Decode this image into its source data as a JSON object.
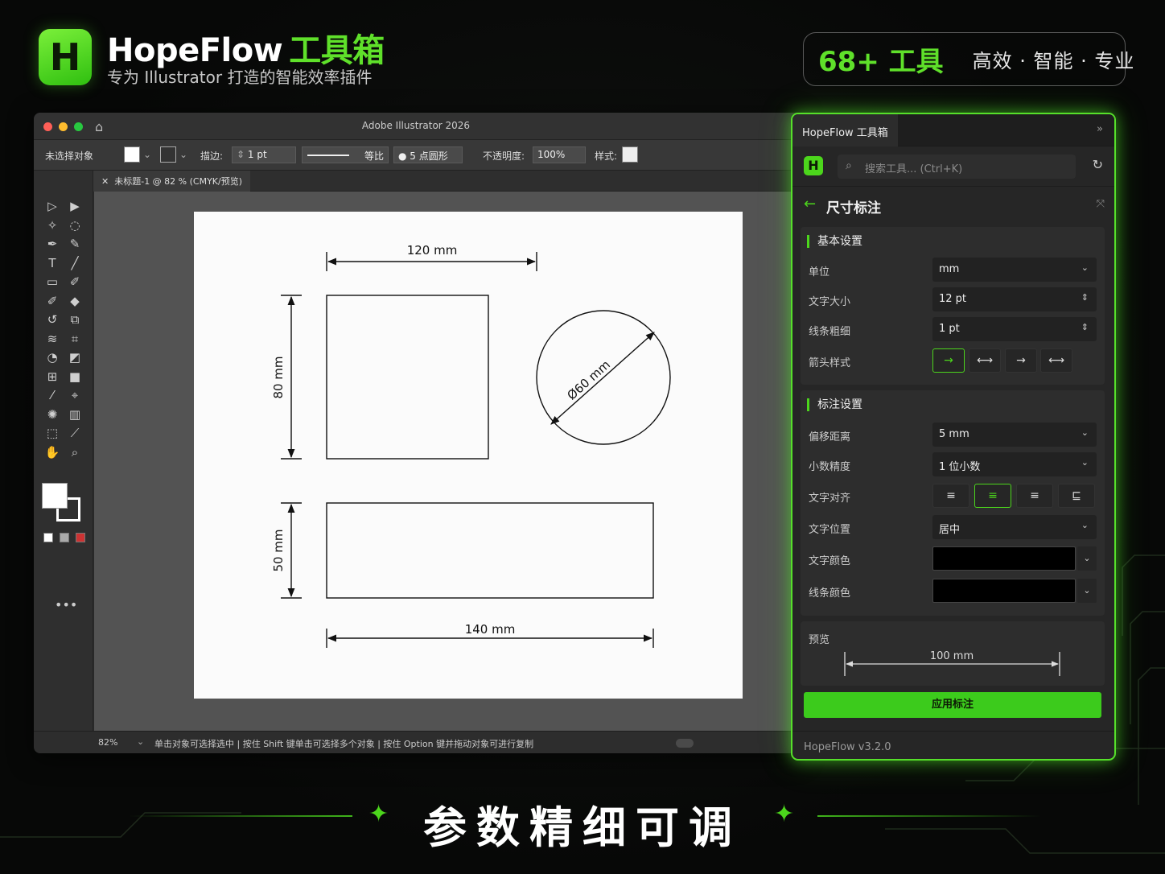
{
  "brand": {
    "logo_letter": "H",
    "name": "HopeFlow",
    "name_cn": "工具箱",
    "subtitle": "专为 Illustrator 打造的智能效率插件"
  },
  "badge": {
    "count": "68+ 工具",
    "tagline": "高效 · 智能 · 专业"
  },
  "illustrator": {
    "window_title": "Adobe Illustrator 2026",
    "control_bar": {
      "selection": "未选择对象",
      "stroke_label": "描边:",
      "stroke_value": "1 pt",
      "profile": "等比",
      "brush": "● 5 点圆形",
      "opacity_label": "不透明度:",
      "opacity_value": "100%",
      "style_label": "样式:"
    },
    "document_tab": "未标题-1 @ 82 % (CMYK/预览)",
    "status": {
      "zoom": "82%",
      "hint": "单击对象可选择选中 | 按住 Shift 键单击可选择多个对象 | 按住 Option 键并拖动对象可进行复制"
    },
    "drawing": {
      "dim_top": "120 mm",
      "dim_left_upper": "80 mm",
      "dim_circle": "Ø60 mm",
      "dim_left_lower": "50 mm",
      "dim_bottom": "140 mm"
    },
    "tools": [
      "selection",
      "direct-selection",
      "magic-wand",
      "lasso",
      "pen",
      "curvature",
      "type",
      "line",
      "rectangle",
      "paintbrush",
      "shaper",
      "eraser",
      "rotate",
      "scale",
      "width",
      "free-transform",
      "shape-builder",
      "perspective",
      "mesh",
      "gradient",
      "eyedropper",
      "blend",
      "symbol-sprayer",
      "column-graph",
      "artboard",
      "slice",
      "hand",
      "zoom"
    ]
  },
  "panel": {
    "tab_title": "HopeFlow 工具箱",
    "search_placeholder": "搜索工具... (Ctrl+K)",
    "page_title": "尺寸标注",
    "basic": {
      "title": "基本设置",
      "unit_label": "单位",
      "unit_value": "mm",
      "font_size_label": "文字大小",
      "font_size_value": "12 pt",
      "line_weight_label": "线条粗细",
      "line_weight_value": "1 pt",
      "arrow_label": "箭头样式",
      "arrow_options": [
        "→",
        "⟷",
        "→",
        "⟷"
      ]
    },
    "dimension": {
      "title": "标注设置",
      "offset_label": "偏移距离",
      "offset_value": "5 mm",
      "precision_label": "小数精度",
      "precision_value": "1 位小数",
      "align_label": "文字对齐",
      "align_options": [
        "≡",
        "≡",
        "≡",
        "⊑"
      ],
      "position_label": "文字位置",
      "position_value": "居中",
      "text_color_label": "文字颜色",
      "text_color": "#000000",
      "line_color_label": "线条颜色",
      "line_color": "#000000"
    },
    "preview": {
      "title": "预览",
      "value": "100 mm"
    },
    "apply_label": "应用标注",
    "version": "HopeFlow v3.2.0"
  },
  "banner": {
    "text": "参数精细可调"
  },
  "colors": {
    "accent": "#4cd61c",
    "background": "#070807",
    "panel": "#262626"
  }
}
